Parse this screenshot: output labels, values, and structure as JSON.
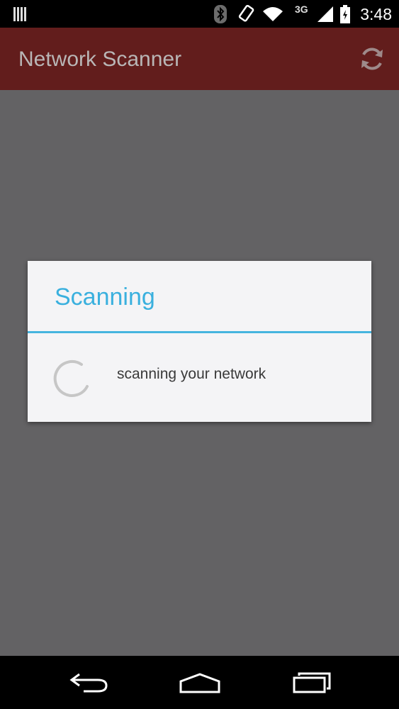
{
  "status_bar": {
    "time": "3:48",
    "network_type": "3G",
    "icons": [
      "notification-icon",
      "bluetooth-icon",
      "rotation-icon",
      "wifi-icon",
      "signal-icon",
      "battery-icon"
    ]
  },
  "action_bar": {
    "title": "Network Scanner",
    "refresh_icon": "refresh-icon",
    "color": "#621d1c"
  },
  "dialog": {
    "title": "Scanning",
    "message": "scanning your network",
    "accent_color": "#3ab0de"
  },
  "nav_bar": {
    "buttons": [
      "back-icon",
      "home-icon",
      "recent-apps-icon"
    ]
  }
}
